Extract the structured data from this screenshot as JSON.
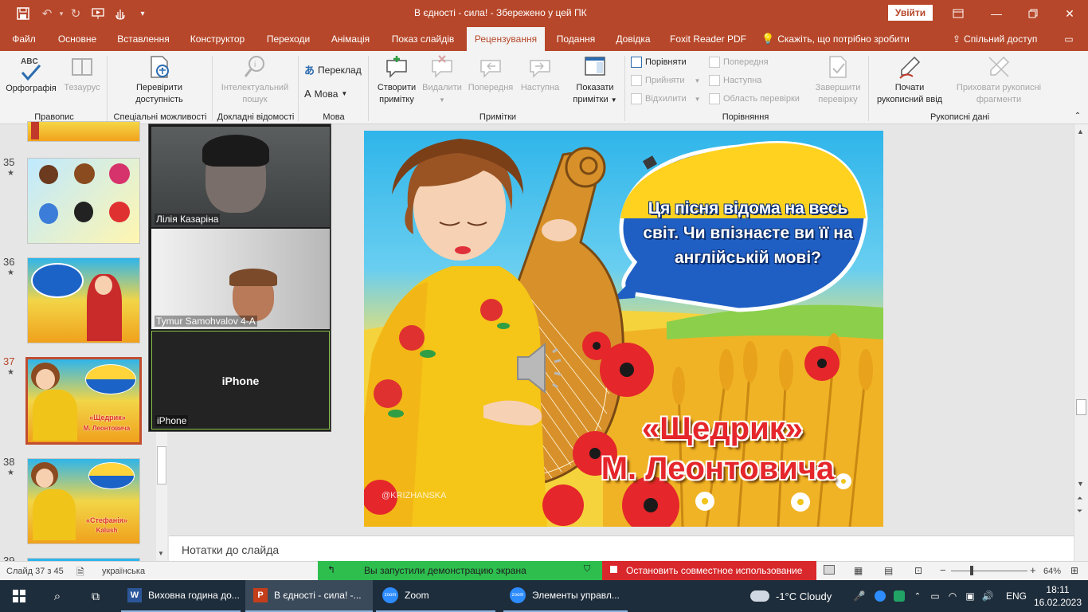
{
  "titlebar": {
    "doc_title": "В єдності - сила!  -  Збережено у цей ПК",
    "signin_label": "Увійти"
  },
  "tabs": [
    {
      "label": "Файл"
    },
    {
      "label": "Основне"
    },
    {
      "label": "Вставлення"
    },
    {
      "label": "Конструктор"
    },
    {
      "label": "Переходи"
    },
    {
      "label": "Анімація"
    },
    {
      "label": "Показ слайдів"
    },
    {
      "label": "Рецензування"
    },
    {
      "label": "Подання"
    },
    {
      "label": "Довідка"
    },
    {
      "label": "Foxit Reader PDF"
    },
    {
      "label": "Скажіть, що потрібно зробити"
    },
    {
      "label": "Спільний доступ"
    }
  ],
  "ribbon": {
    "spelling": {
      "label": "Орфографія",
      "abc": "ABC",
      "thesaurus": "Тезаурус",
      "group": "Правопис"
    },
    "accessibility": {
      "line1": "Перевірити",
      "line2": "доступність",
      "group": "Спеціальні можливості"
    },
    "insights": {
      "line1": "Інтелектуальний",
      "line2": "пошук",
      "group": "Докладні відомості"
    },
    "language": {
      "translate": "Переклад",
      "language": "Мова",
      "group": "Мова"
    },
    "comments": {
      "new_line1": "Створити",
      "new_line2": "примітку",
      "delete": "Видалити",
      "prev": "Попередня",
      "next": "Наступна",
      "show_line1": "Показати",
      "show_line2": "примітки",
      "group": "Примітки"
    },
    "compare": {
      "compare": "Порівняти",
      "accept": "Прийняти",
      "reject": "Відхилити",
      "prev": "Попередня",
      "next": "Наступна",
      "pane": "Область перевірки",
      "end_line1": "Завершити",
      "end_line2": "перевірку",
      "group": "Порівняння"
    },
    "ink": {
      "start_line1": "Почати",
      "start_line2": "рукописний ввід",
      "hide_line1": "Приховати рукописні",
      "hide_line2": "фрагменти",
      "group": "Рукописні дані"
    }
  },
  "slides": [
    {
      "num": "35",
      "star": "★"
    },
    {
      "num": "36",
      "star": "★"
    },
    {
      "num": "37",
      "star": "★",
      "active": true
    },
    {
      "num": "38",
      "star": "★"
    },
    {
      "num": "39"
    }
  ],
  "thumb_texts": {
    "t37_title": "«Щедрик»",
    "t37_sub": "М. Леонтовича",
    "t38_title": "«Стефанія»",
    "t38_sub": "Kalush"
  },
  "slide": {
    "bubble_text": "Ця пісня відома на весь світ. Чи впізнаєте ви її на  англійській мові?",
    "title_line1": "«Щедрик»",
    "title_line2": "М. Леонтовича",
    "watermark": "@KRIZHANSKA"
  },
  "notes_placeholder": "Нотатки до слайда",
  "zoom": {
    "participants": [
      {
        "name": "Лілія Казаріна"
      },
      {
        "name": "Tymur Samohvalov 4-А"
      },
      {
        "name": "iPhone",
        "center_label": "iPhone"
      }
    ]
  },
  "statusbar": {
    "slide_info": "Слайд 37 з 45",
    "language": "українська",
    "zoom": "64%",
    "sharing_text": "Вы запустили демонстрацию экрана",
    "stop_text": "Остановить совместное использование"
  },
  "taskbar": {
    "apps": [
      {
        "label": "Виховна година до..."
      },
      {
        "label": "В єдності - сила! -..."
      },
      {
        "label": "Zoom"
      },
      {
        "label": "Элементы управл..."
      }
    ],
    "weather": "-1°C  Cloudy",
    "lang": "ENG",
    "time": "18:11",
    "date": "16.02.2023"
  },
  "colors": {
    "accent": "#b7472a",
    "share_green": "#2dbe4e",
    "share_red": "#d8282b",
    "taskbar": "#1e2d3b"
  }
}
